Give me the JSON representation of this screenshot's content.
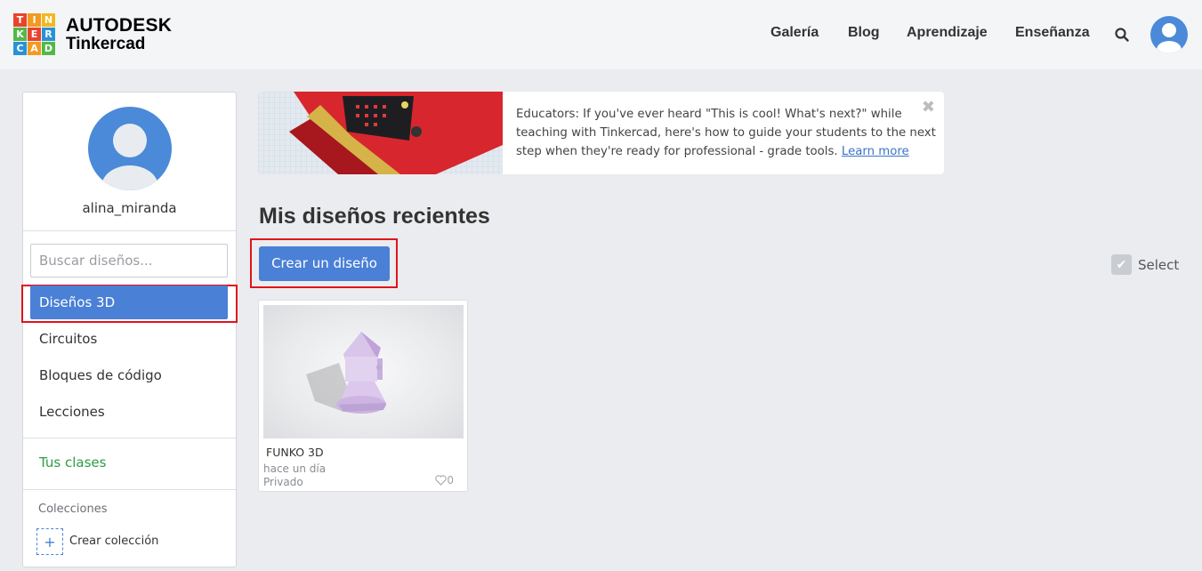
{
  "colors": {
    "accent": "#4a80d6",
    "highlight_outline": "#e0141b",
    "class_link": "#2e9d44",
    "avatar": "#4a8ad8",
    "background": "#ebecef"
  },
  "header": {
    "logo_letters": [
      "T",
      "I",
      "N",
      "K",
      "E",
      "R",
      "C",
      "A",
      "D"
    ],
    "brand_top": "AUTODESK",
    "brand_bottom": "Tinkercad",
    "nav": [
      "Galería",
      "Blog",
      "Aprendizaje",
      "Enseñanza"
    ],
    "search_icon": "search-icon",
    "avatar_icon": "user-avatar-icon"
  },
  "sidebar": {
    "username": "alina_miranda",
    "search_placeholder": "Buscar diseños...",
    "menu": [
      "Diseños 3D",
      "Circuitos",
      "Bloques de código",
      "Lecciones"
    ],
    "active_index": 0,
    "classes_label": "Tus clases",
    "collections_title": "Colecciones",
    "plus_symbol": "+",
    "create_collection": "Crear colección"
  },
  "banner": {
    "text": "Educators: If you've ever heard \"This is cool! What's next?\" while teaching with Tinkercad, here's how to guide your students to the next step when they're ready for professional - grade tools. ",
    "link": "Learn more",
    "close_symbol": "✖"
  },
  "main": {
    "title": "Mis diseños recientes",
    "create_button": "Crear un diseño",
    "select_check": "✔",
    "select_label": "Select"
  },
  "designs": [
    {
      "title": "FUNKO 3D",
      "time": "hace un día",
      "visibility": "Privado",
      "likes": "0"
    }
  ]
}
